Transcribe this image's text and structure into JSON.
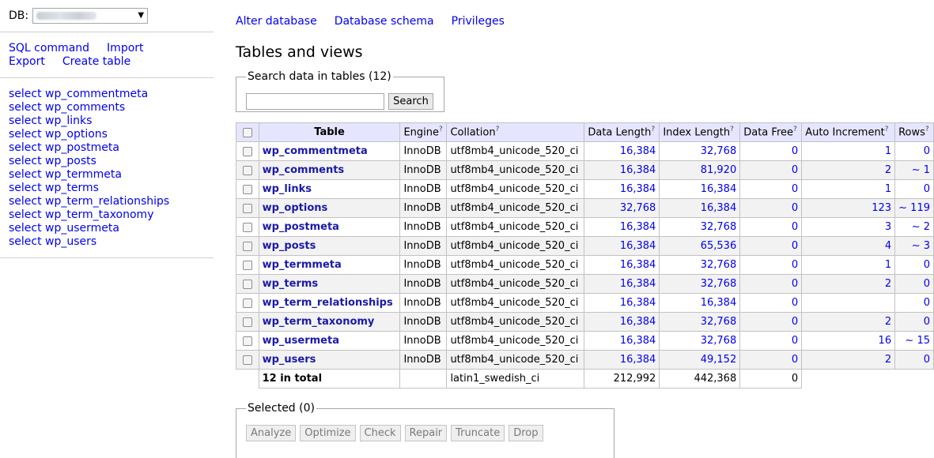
{
  "sidebar": {
    "db_label": "DB:",
    "db_selected": "wp_database",
    "links_row1": [
      "SQL command",
      "Import"
    ],
    "links_row2": [
      "Export",
      "Create table"
    ],
    "table_links": [
      "select wp_commentmeta",
      "select wp_comments",
      "select wp_links",
      "select wp_options",
      "select wp_postmeta",
      "select wp_posts",
      "select wp_termmeta",
      "select wp_terms",
      "select wp_term_relationships",
      "select wp_term_taxonomy",
      "select wp_usermeta",
      "select wp_users"
    ]
  },
  "topnav": [
    "Alter database",
    "Database schema",
    "Privileges"
  ],
  "page_title": "Tables and views",
  "search": {
    "legend": "Search data in tables (12)",
    "value": "",
    "placeholder": "",
    "button": "Search"
  },
  "table": {
    "headers": {
      "name": "Table",
      "engine": "Engine",
      "collation": "Collation",
      "data_length": "Data Length",
      "index_length": "Index Length",
      "data_free": "Data Free",
      "auto_increment": "Auto Increment",
      "rows": "Rows",
      "help_mark": "?"
    },
    "rows": [
      {
        "name": "wp_commentmeta",
        "engine": "InnoDB",
        "collation": "utf8mb4_unicode_520_ci",
        "data_length": "16,384",
        "index_length": "32,768",
        "data_free": "0",
        "auto_increment": "1",
        "rows": "0"
      },
      {
        "name": "wp_comments",
        "engine": "InnoDB",
        "collation": "utf8mb4_unicode_520_ci",
        "data_length": "16,384",
        "index_length": "81,920",
        "data_free": "0",
        "auto_increment": "2",
        "rows": "~ 1"
      },
      {
        "name": "wp_links",
        "engine": "InnoDB",
        "collation": "utf8mb4_unicode_520_ci",
        "data_length": "16,384",
        "index_length": "16,384",
        "data_free": "0",
        "auto_increment": "1",
        "rows": "0"
      },
      {
        "name": "wp_options",
        "engine": "InnoDB",
        "collation": "utf8mb4_unicode_520_ci",
        "data_length": "32,768",
        "index_length": "16,384",
        "data_free": "0",
        "auto_increment": "123",
        "rows": "~ 119"
      },
      {
        "name": "wp_postmeta",
        "engine": "InnoDB",
        "collation": "utf8mb4_unicode_520_ci",
        "data_length": "16,384",
        "index_length": "32,768",
        "data_free": "0",
        "auto_increment": "3",
        "rows": "~ 2"
      },
      {
        "name": "wp_posts",
        "engine": "InnoDB",
        "collation": "utf8mb4_unicode_520_ci",
        "data_length": "16,384",
        "index_length": "65,536",
        "data_free": "0",
        "auto_increment": "4",
        "rows": "~ 3"
      },
      {
        "name": "wp_termmeta",
        "engine": "InnoDB",
        "collation": "utf8mb4_unicode_520_ci",
        "data_length": "16,384",
        "index_length": "32,768",
        "data_free": "0",
        "auto_increment": "1",
        "rows": "0"
      },
      {
        "name": "wp_terms",
        "engine": "InnoDB",
        "collation": "utf8mb4_unicode_520_ci",
        "data_length": "16,384",
        "index_length": "32,768",
        "data_free": "0",
        "auto_increment": "2",
        "rows": "0"
      },
      {
        "name": "wp_term_relationships",
        "engine": "InnoDB",
        "collation": "utf8mb4_unicode_520_ci",
        "data_length": "16,384",
        "index_length": "16,384",
        "data_free": "0",
        "auto_increment": "",
        "rows": "0"
      },
      {
        "name": "wp_term_taxonomy",
        "engine": "InnoDB",
        "collation": "utf8mb4_unicode_520_ci",
        "data_length": "16,384",
        "index_length": "32,768",
        "data_free": "0",
        "auto_increment": "2",
        "rows": "0"
      },
      {
        "name": "wp_usermeta",
        "engine": "InnoDB",
        "collation": "utf8mb4_unicode_520_ci",
        "data_length": "16,384",
        "index_length": "32,768",
        "data_free": "0",
        "auto_increment": "16",
        "rows": "~ 15"
      },
      {
        "name": "wp_users",
        "engine": "InnoDB",
        "collation": "utf8mb4_unicode_520_ci",
        "data_length": "16,384",
        "index_length": "49,152",
        "data_free": "0",
        "auto_increment": "2",
        "rows": "0"
      }
    ],
    "total": {
      "label": "12 in total",
      "collation": "latin1_swedish_ci",
      "data_length": "212,992",
      "index_length": "442,368",
      "data_free": "0"
    }
  },
  "selected": {
    "legend": "Selected (0)",
    "buttons": [
      "Analyze",
      "Optimize",
      "Check",
      "Repair",
      "Truncate",
      "Drop"
    ]
  }
}
